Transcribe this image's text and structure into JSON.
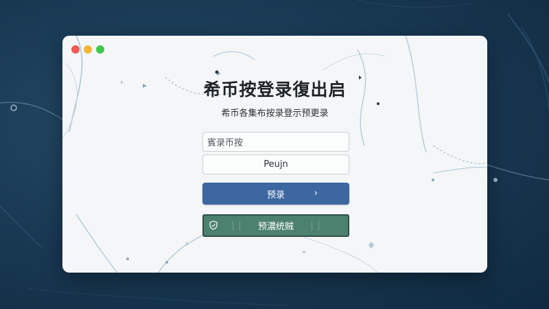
{
  "window": {
    "controls": [
      "close",
      "minimize",
      "maximize"
    ]
  },
  "login": {
    "title": "希币按登录復出启",
    "subtitle": "希币各集布按录登示预更录",
    "username_placeholder": "賓录币按",
    "password_value": "Peujn",
    "primary_button_label": "预录",
    "primary_button_icon": "chevron-right-icon",
    "secondary_button_label": "预濃统贼",
    "secondary_button_icon": "shield-icon"
  },
  "colors": {
    "background": "#1a3a55",
    "window": "#f4f6f7",
    "primary_button": "#3c67a1",
    "secondary_button": "#4c8170",
    "close": "#ec5b55",
    "minimize": "#f2b537",
    "maximize": "#3fc84e"
  }
}
